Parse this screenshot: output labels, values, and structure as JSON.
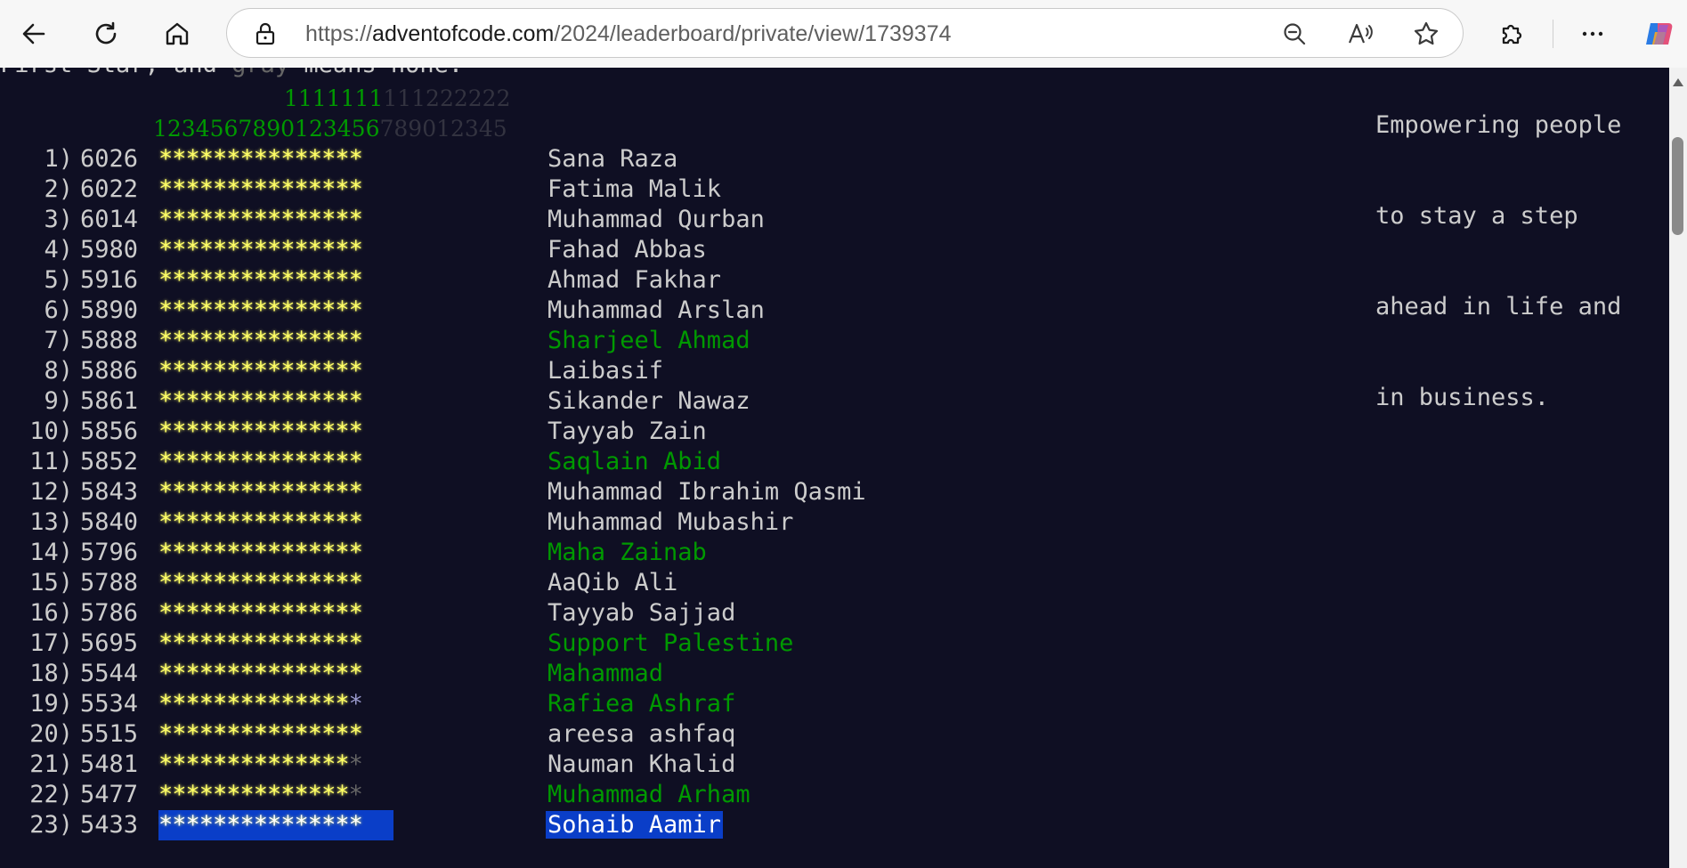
{
  "browser": {
    "url_prefix": "https://",
    "url_host": "adventofcode.com",
    "url_path": "/2024/leaderboard/private/view/1739374",
    "icons": [
      "back-icon",
      "refresh-icon",
      "home-icon",
      "lock-icon",
      "zoom-out-icon",
      "read-aloud-icon",
      "favorite-star-icon",
      "extensions-icon",
      "more-icon",
      "copilot-icon"
    ]
  },
  "page": {
    "top_line_a": "First Star, and ",
    "top_line_grey": "gray",
    "top_line_b": " means none.",
    "sponsor_lines": [
      "Empowering people",
      "to stay a step",
      "ahead in life and",
      "in business."
    ],
    "day_tens_green": "1111111",
    "day_tens_dim": "111222222",
    "day_units_green": "1234567890123456",
    "day_units_dim": "789012345",
    "colors": {
      "gold": "#ffff66",
      "anon": "#009900",
      "highlight": "#0a3ec8",
      "bg": "#0f0f23"
    }
  },
  "leaderboard": [
    {
      "rank": "1)",
      "score": "6026",
      "gold": "***************",
      "silver": "",
      "none": "",
      "name": "Sana Raza",
      "anon": false
    },
    {
      "rank": "2)",
      "score": "6022",
      "gold": "***************",
      "silver": "",
      "none": "",
      "name": "Fatima Malik",
      "anon": false
    },
    {
      "rank": "3)",
      "score": "6014",
      "gold": "***************",
      "silver": "",
      "none": "",
      "name": "Muhammad Qurban",
      "anon": false
    },
    {
      "rank": "4)",
      "score": "5980",
      "gold": "***************",
      "silver": "",
      "none": "",
      "name": "Fahad Abbas",
      "anon": false
    },
    {
      "rank": "5)",
      "score": "5916",
      "gold": "***************",
      "silver": "",
      "none": "",
      "name": "Ahmad Fakhar",
      "anon": false
    },
    {
      "rank": "6)",
      "score": "5890",
      "gold": "***************",
      "silver": "",
      "none": "",
      "name": "Muhammad Arslan",
      "anon": false
    },
    {
      "rank": "7)",
      "score": "5888",
      "gold": "***************",
      "silver": "",
      "none": "",
      "name": "Sharjeel Ahmad",
      "anon": true
    },
    {
      "rank": "8)",
      "score": "5886",
      "gold": "***************",
      "silver": "",
      "none": "",
      "name": "Laibasif",
      "anon": false
    },
    {
      "rank": "9)",
      "score": "5861",
      "gold": "***************",
      "silver": "",
      "none": "",
      "name": "Sikander Nawaz",
      "anon": false
    },
    {
      "rank": "10)",
      "score": "5856",
      "gold": "***************",
      "silver": "",
      "none": "",
      "name": "Tayyab Zain",
      "anon": false
    },
    {
      "rank": "11)",
      "score": "5852",
      "gold": "***************",
      "silver": "",
      "none": "",
      "name": "Saqlain Abid",
      "anon": true
    },
    {
      "rank": "12)",
      "score": "5843",
      "gold": "***************",
      "silver": "",
      "none": "",
      "name": "Muhammad Ibrahim Qasmi",
      "anon": false
    },
    {
      "rank": "13)",
      "score": "5840",
      "gold": "***************",
      "silver": "",
      "none": "",
      "name": "Muhammad Mubashir",
      "anon": false
    },
    {
      "rank": "14)",
      "score": "5796",
      "gold": "***************",
      "silver": "",
      "none": "",
      "name": "Maha Zainab",
      "anon": true
    },
    {
      "rank": "15)",
      "score": "5788",
      "gold": "***************",
      "silver": "",
      "none": "",
      "name": "AaQib Ali",
      "anon": false
    },
    {
      "rank": "16)",
      "score": "5786",
      "gold": "***************",
      "silver": "",
      "none": "",
      "name": "Tayyab Sajjad",
      "anon": false
    },
    {
      "rank": "17)",
      "score": "5695",
      "gold": "***************",
      "silver": "",
      "none": "",
      "name": "Support Palestine",
      "anon": true
    },
    {
      "rank": "18)",
      "score": "5544",
      "gold": "***************",
      "silver": "",
      "none": "",
      "name": "Mahammad",
      "anon": true
    },
    {
      "rank": "19)",
      "score": "5534",
      "gold": "**************",
      "silver": "*",
      "none": "",
      "name": "Rafiea Ashraf",
      "anon": true
    },
    {
      "rank": "20)",
      "score": "5515",
      "gold": "***************",
      "silver": "",
      "none": "",
      "name": "areesa ashfaq",
      "anon": false
    },
    {
      "rank": "21)",
      "score": "5481",
      "gold": "**************",
      "silver": "",
      "none": "*",
      "name": "Nauman Khalid",
      "anon": false
    },
    {
      "rank": "22)",
      "score": "5477",
      "gold": "**************",
      "silver": "",
      "none": "*",
      "name": "Muhammad Arham",
      "anon": true
    },
    {
      "rank": "23)",
      "score": "5433",
      "gold": "***************",
      "silver": "",
      "none": "",
      "name": "Sohaib Aamir",
      "anon": false,
      "highlight": true
    }
  ]
}
